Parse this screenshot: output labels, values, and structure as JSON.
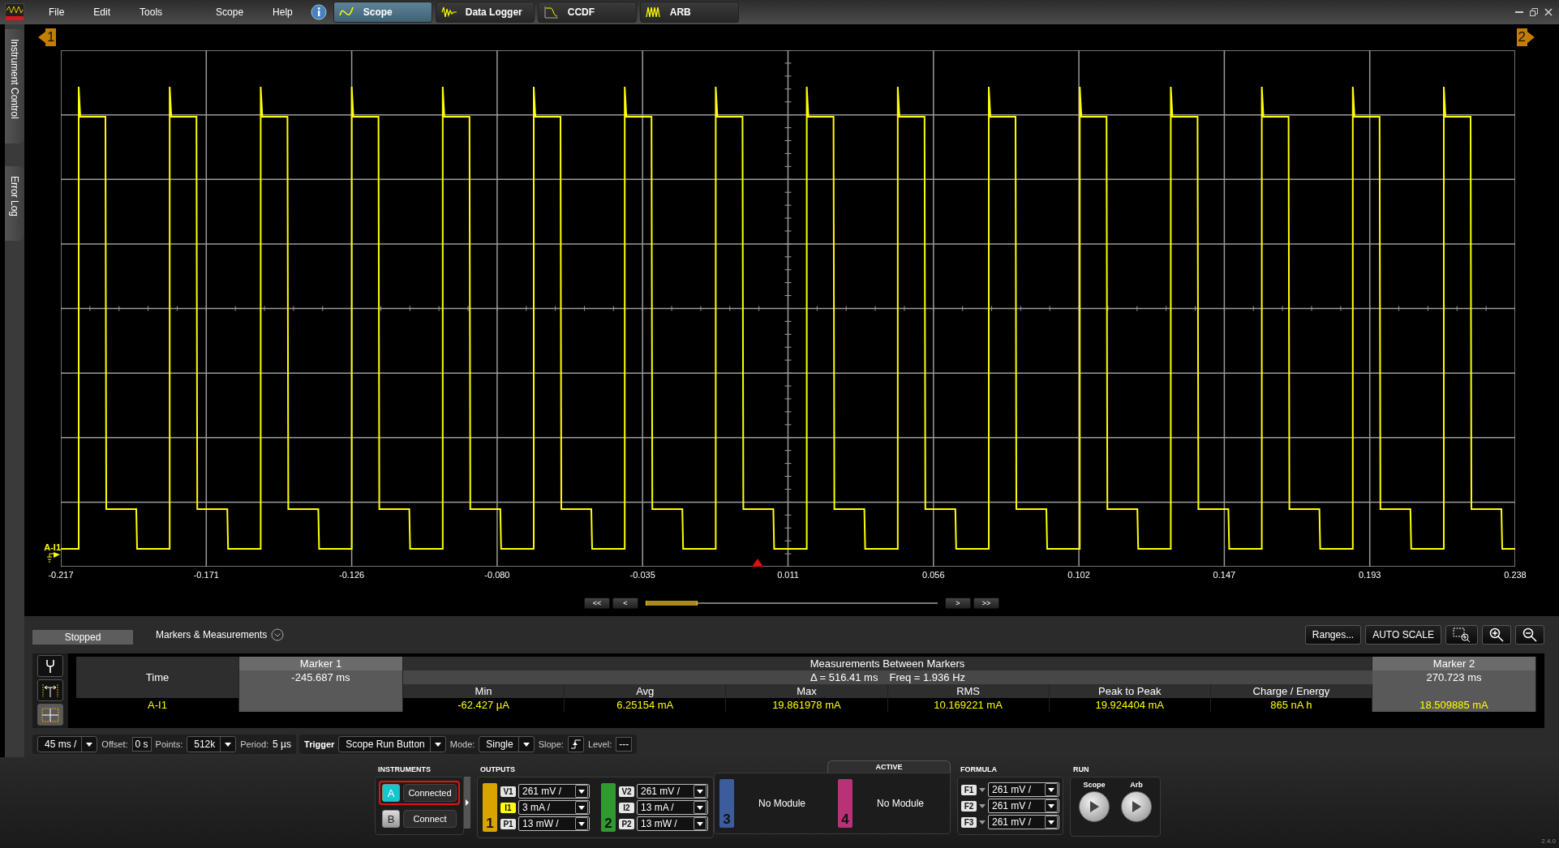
{
  "menu": [
    "File",
    "Edit",
    "Tools",
    "Scope",
    "Help"
  ],
  "mode_tabs": [
    {
      "label": "Scope",
      "selected": true
    },
    {
      "label": "Data Logger",
      "selected": false
    },
    {
      "label": "CCDF",
      "selected": false
    },
    {
      "label": "ARB",
      "selected": false
    }
  ],
  "side_tabs": [
    "Instrument Control",
    "Error Log"
  ],
  "scope": {
    "marker_1": "1",
    "marker_2": "2",
    "trace_label": "A-I1",
    "x_ticks": [
      "-0.217",
      "-0.171",
      "-0.126",
      "-0.080",
      "-0.035",
      "0.011",
      "0.056",
      "0.102",
      "0.147",
      "0.193",
      "0.238"
    ],
    "nav": [
      "<<",
      "<",
      ">",
      ">>"
    ]
  },
  "status": "Stopped",
  "panel_title": "Markers & Measurements",
  "panel_buttons": [
    "Ranges...",
    "AUTO SCALE"
  ],
  "tools": [
    {
      "selected": false
    },
    {
      "selected": false
    },
    {
      "selected": true
    }
  ],
  "measurements": {
    "marker_1_header": "Marker 1",
    "between_header": "Measurements Between Markers",
    "marker_2_header": "Marker 2",
    "time_label": "Time",
    "marker_1_time": "-245.687 ms",
    "delta": "Δ = 516.41 ms",
    "freq": "Freq = 1.936 Hz",
    "marker_2_time": "270.723 ms",
    "columns": [
      "Min",
      "Avg",
      "Max",
      "RMS",
      "Peak to Peak",
      "Charge / Energy"
    ],
    "rows": [
      {
        "trace": "A-I1",
        "values": [
          "-62.427 µA",
          "6.25154 mA",
          "19.861978 mA",
          "10.169221 mA",
          "19.924404 mA",
          "865 nA h"
        ],
        "marker_2_value": "18.509885 mA"
      }
    ]
  },
  "acquisition": {
    "timebase": "45 ms /",
    "offset_label": "Offset:",
    "offset": "0 s",
    "points_label": "Points:",
    "points": "512k",
    "period_label": "Period:",
    "period": "5 µs",
    "trigger_label": "Trigger",
    "trigger": "Scope Run Button",
    "mode_label": "Mode:",
    "mode": "Single",
    "slope_label": "Slope:",
    "trigger_level_label": "Level:",
    "trigger_level": "---"
  },
  "instruments": {
    "title": "INSTRUMENTS",
    "items": [
      {
        "letter": "A",
        "status": "Connected",
        "selected": true
      },
      {
        "letter": "B",
        "status": "Connect",
        "selected": false
      }
    ]
  },
  "outputs_title": "OUTPUTS",
  "active_title": "ACTIVE",
  "channels": [
    {
      "number": "1",
      "color": "#d9a400",
      "kind": "module",
      "rows": [
        {
          "tag": "V1",
          "value": "261 mV /",
          "selected": false
        },
        {
          "tag": "I1",
          "value": "3 mA /",
          "selected": true
        },
        {
          "tag": "P1",
          "value": "13 mW /",
          "selected": false
        }
      ]
    },
    {
      "number": "2",
      "color": "#2f9a2f",
      "kind": "module",
      "rows": [
        {
          "tag": "V2",
          "value": "261 mV /",
          "selected": false
        },
        {
          "tag": "I2",
          "value": "13 mA /",
          "selected": false
        },
        {
          "tag": "P2",
          "value": "13 mW /",
          "selected": false
        }
      ]
    },
    {
      "number": "3",
      "color": "#3c5c9c",
      "kind": "empty",
      "text": "No Module"
    },
    {
      "number": "4",
      "color": "#b83278",
      "kind": "empty",
      "text": "No Module"
    }
  ],
  "formula": {
    "title": "FORMULA",
    "rows": [
      {
        "tag": "F1",
        "value": "261 mV /"
      },
      {
        "tag": "F2",
        "value": "261 mV /"
      },
      {
        "tag": "F3",
        "value": "261 mV /"
      }
    ]
  },
  "run": {
    "title": "RUN",
    "buttons": [
      "Scope",
      "Arb"
    ]
  },
  "version": "2.4.0"
}
